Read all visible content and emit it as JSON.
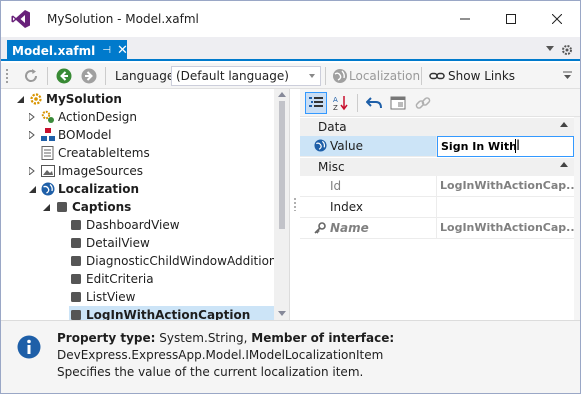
{
  "window": {
    "title": "MySolution - Model.xafml"
  },
  "document_tab": {
    "label": "Model.xafml",
    "pin_glyph": "⊣",
    "close_glyph": "✕"
  },
  "toolbar": {
    "language_label": "Language",
    "language_value": "(Default language)",
    "localization_label": "Localization",
    "show_links_label": "Show Links"
  },
  "tree": {
    "nodes": [
      {
        "label": "MySolution",
        "bold": true,
        "expanded": true
      },
      {
        "label": "ActionDesign",
        "bold": false
      },
      {
        "label": "BOModel",
        "bold": false
      },
      {
        "label": "CreatableItems",
        "bold": false
      },
      {
        "label": "ImageSources",
        "bold": false
      },
      {
        "label": "Localization",
        "bold": true,
        "expanded": true
      },
      {
        "label": "Captions",
        "bold": true,
        "expanded": true
      },
      {
        "label": "DashboardView",
        "bold": false
      },
      {
        "label": "DetailView",
        "bold": false
      },
      {
        "label": "DiagnosticChildWindowAddition",
        "bold": false
      },
      {
        "label": "EditCriteria",
        "bold": false
      },
      {
        "label": "ListView",
        "bold": false
      },
      {
        "label": "LogInWithActionCaption",
        "bold": true,
        "selected": true
      }
    ]
  },
  "properties": {
    "categories": [
      {
        "name": "Data",
        "rows": [
          {
            "name": "Value",
            "value": "Sign In With",
            "editing": true
          }
        ]
      },
      {
        "name": "Misc",
        "rows": [
          {
            "name": "Id",
            "value": "LogInWithActionCap..."
          },
          {
            "name": "Index",
            "value": ""
          },
          {
            "name": "Name",
            "value": "LogInWithActionCap..."
          }
        ]
      }
    ]
  },
  "info": {
    "property_type_label": "Property type:",
    "property_type_value": " System.String, ",
    "member_label": "Member of interface:",
    "interface_name": "DevExpress.ExpressApp.Model.IModelLocalizationItem",
    "description": "Specifies the value of the current localization item."
  },
  "colors": {
    "accent": "#007acc",
    "selection": "#cce4f7",
    "info_icon": "#1e5fa8"
  }
}
